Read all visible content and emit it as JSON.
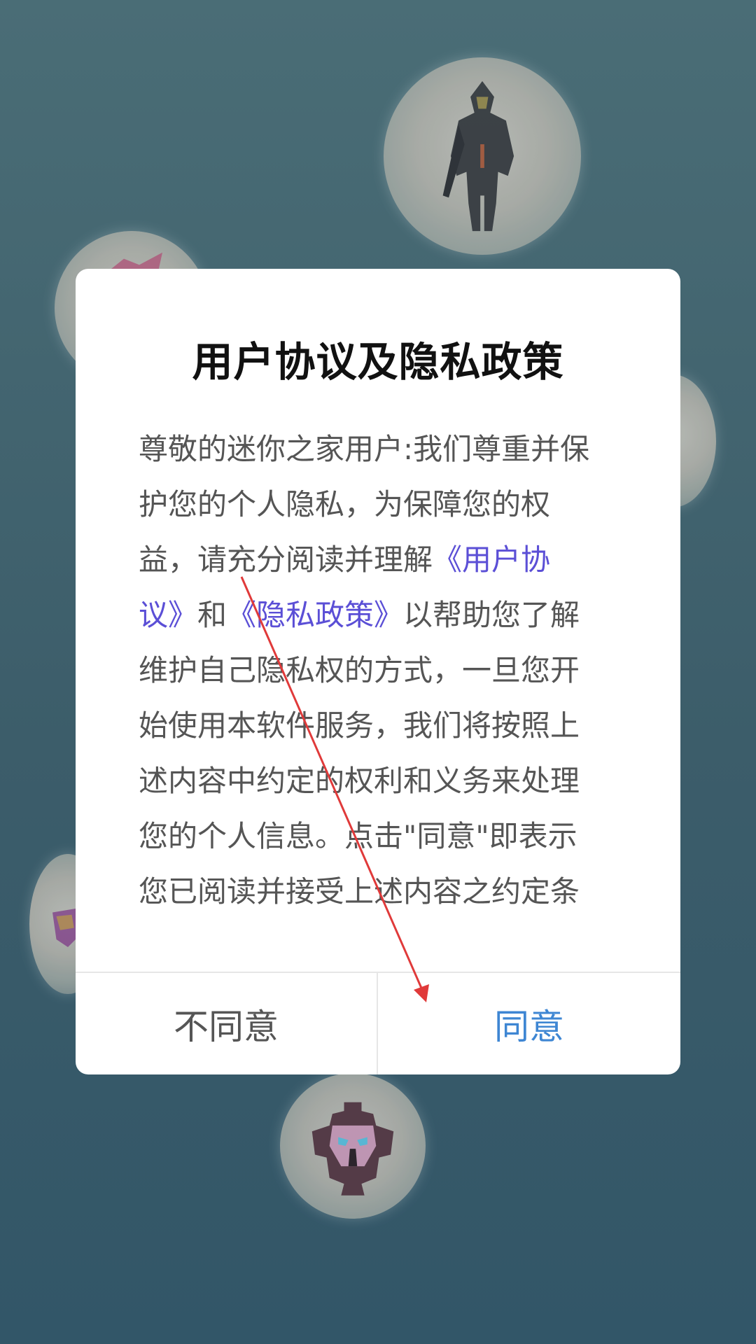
{
  "dialog": {
    "title": "用户协议及隐私政策",
    "body_parts": {
      "p1": "尊敬的迷你之家用户:我们尊重并保护您的个人隐私，为保障您的权益，请充分阅读并理解",
      "link_user_agreement": "《用户协议》",
      "p2": "和",
      "link_privacy_policy": "《隐私政策》",
      "p3": "以帮助您了解维护自己隐私权的方式，一旦您开始使用本软件服务，我们将按照上述内容中约定的权利和义务来处理您的个人信息。点击\"同意\"即表示您已阅读并接受上述内容之约定条"
    },
    "buttons": {
      "disagree": "不同意",
      "agree": "同意"
    }
  },
  "colors": {
    "background": "#3f626d",
    "link": "#5b4fd6",
    "agree_button": "#3e86d3",
    "annotation_arrow": "#e03a3a"
  },
  "icons": {
    "background_characters": "game-character-orbs"
  }
}
